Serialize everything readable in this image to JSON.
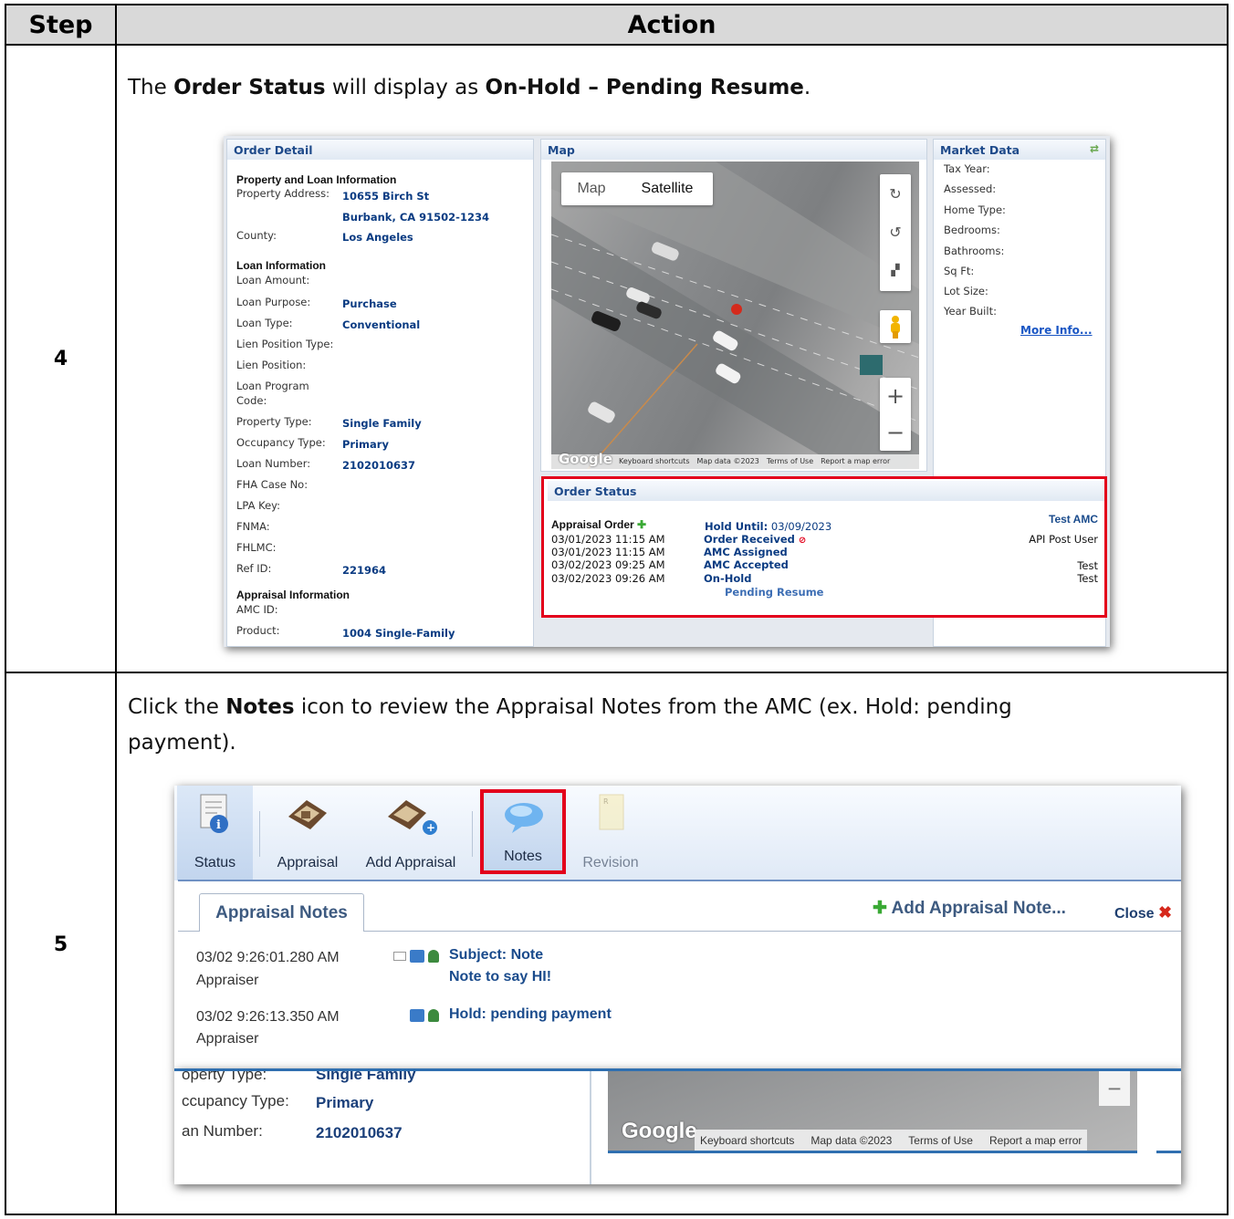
{
  "table": {
    "header": {
      "step": "Step",
      "action": "Action"
    },
    "rows": [
      {
        "step": "4",
        "instruction_prefix": "The ",
        "instruction_b1": "Order Status",
        "instruction_mid": " will display as ",
        "instruction_b2": "On-Hold – Pending Resume",
        "instruction_suffix": "."
      },
      {
        "step": "5",
        "instruction_prefix": "Click the ",
        "instruction_b1": "Notes",
        "instruction_line1": " icon to review the Appraisal Notes from the AMC (ex. Hold: pending",
        "instruction_line2": "payment)."
      }
    ]
  },
  "order_detail": {
    "title": "Order Detail",
    "sec_property": "Property and Loan Information",
    "property_address_label": "Property Address:",
    "property_address_1": "10655 Birch St",
    "property_address_2": "Burbank, CA 91502-1234",
    "county_label": "County:",
    "county": "Los Angeles",
    "sec_loan": "Loan Information",
    "loan_amount_label": "Loan Amount:",
    "loan_purpose_label": "Loan Purpose:",
    "loan_purpose": "Purchase",
    "loan_type_label": "Loan Type:",
    "loan_type": "Conventional",
    "lien_position_type_label": "Lien Position Type:",
    "lien_position_label": "Lien Position:",
    "loan_program_code_label_1": "Loan Program",
    "loan_program_code_label_2": "Code:",
    "property_type_label": "Property Type:",
    "property_type": "Single Family",
    "occupancy_type_label": "Occupancy Type:",
    "occupancy_type": "Primary",
    "loan_number_label": "Loan Number:",
    "loan_number": "2102010637",
    "fha_case_label": "FHA Case No:",
    "lpa_key_label": "LPA Key:",
    "fnma_label": "FNMA:",
    "fhlmc_label": "FHLMC:",
    "ref_id_label": "Ref ID:",
    "ref_id": "221964",
    "sec_appraisal": "Appraisal Information",
    "amc_id_label": "AMC ID:",
    "product_label": "Product:",
    "product": "1004 Single-Family"
  },
  "map": {
    "title": "Map",
    "btn_map": "Map",
    "btn_satellite": "Satellite",
    "google": "Google",
    "footer": [
      "Keyboard shortcuts",
      "Map data ©2023",
      "Terms of Use",
      "Report a map error"
    ]
  },
  "market_data": {
    "title": "Market Data",
    "labels": [
      "Tax Year:",
      "Assessed:",
      "Home Type:",
      "Bedrooms:",
      "Bathrooms:",
      "Sq Ft:",
      "Lot Size:",
      "Year Built:"
    ],
    "more_info": "More Info..."
  },
  "order_status": {
    "title": "Order Status",
    "appraisal_order": "Appraisal Order",
    "hold_until_label": "Hold Until:",
    "hold_until": "03/09/2023",
    "amc": "Test AMC",
    "events": [
      {
        "date": "03/01/2023 11:15 AM",
        "status": "Order Received",
        "user": "API Post User"
      },
      {
        "date": "03/01/2023 11:15 AM",
        "status": "AMC Assigned",
        "user": ""
      },
      {
        "date": "03/02/2023 09:25 AM",
        "status": "AMC Accepted",
        "user": "Test"
      },
      {
        "date": "03/02/2023 09:26 AM",
        "status": "On-Hold",
        "user": "Test"
      }
    ],
    "pending": "Pending Resume"
  },
  "toolbar": {
    "status": "Status",
    "appraisal": "Appraisal",
    "add_appraisal": "Add Appraisal",
    "notes": "Notes",
    "revision": "Revision"
  },
  "notes_panel": {
    "tab": "Appraisal Notes",
    "add_note": "Add Appraisal Note...",
    "close": "Close",
    "notes": [
      {
        "time": "03/02 9:26:01.280 AM",
        "author": "Appraiser",
        "subject": "Subject: Note",
        "body": "Note to say HI!"
      },
      {
        "time": "03/02 9:26:13.350 AM",
        "author": "Appraiser",
        "subject": "Hold: pending payment",
        "body": ""
      }
    ]
  },
  "background_detail": {
    "property_type_label": "operty Type:",
    "property_type": "Single Family",
    "occupancy_label": "ccupancy Type:",
    "occupancy": "Primary",
    "loan_number_label": "an Number:",
    "loan_number": "2102010637",
    "google": "Google",
    "footer": [
      "Keyboard shortcuts",
      "Map data ©2023",
      "Terms of Use",
      "Report a map error"
    ]
  }
}
